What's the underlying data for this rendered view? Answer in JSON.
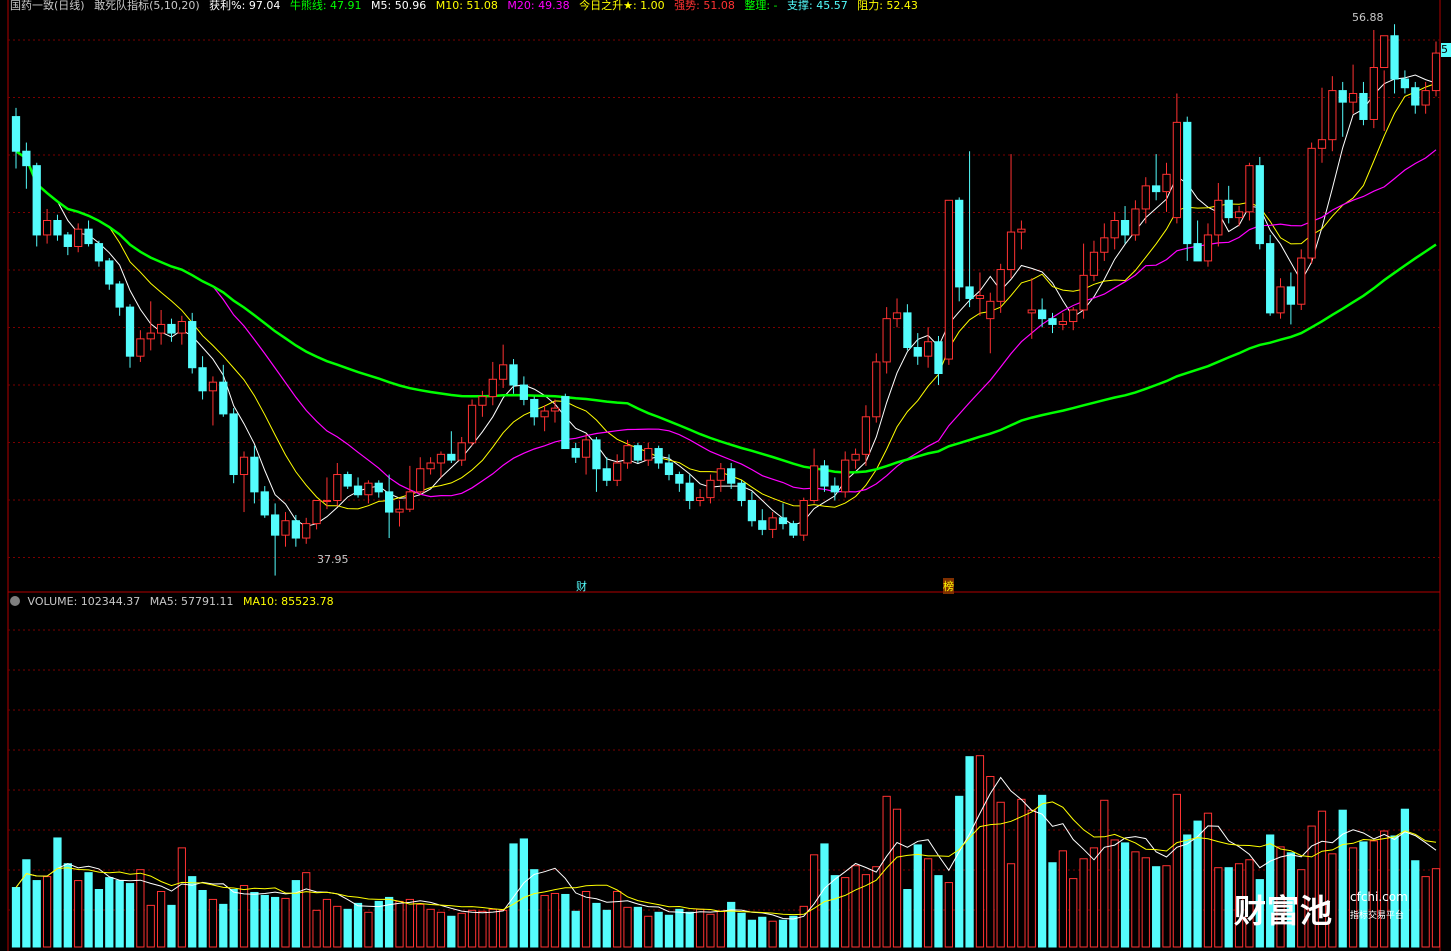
{
  "header": {
    "stock": "国药一致(日线)",
    "indicator": "敢死队指标(5,10,20)",
    "profit": "获利%: 97.04",
    "bull": "牛熊线: 47.91",
    "m5": "M5: 50.96",
    "m10": "M10: 51.08",
    "m20": "M20: 49.38",
    "rise": "今日之升★: 1.00",
    "strong": "强势: 51.08",
    "tidy": "整理: -",
    "support": "支撑: 45.57",
    "resist": "阻力: 52.43"
  },
  "volume_header": {
    "vol": "VOLUME: 102344.37",
    "ma5": "MA5: 57791.11",
    "ma10": "MA10: 85523.78"
  },
  "labels": {
    "high": "56.88",
    "low": "37.95",
    "cai": "财",
    "bang": "榜",
    "edge": "5"
  },
  "colors": {
    "up": "#ff3232",
    "down": "#54fcfc",
    "ma5": "#ffffff",
    "ma10": "#ffff00",
    "ma20": "#ff00ff",
    "ma60": "#00ff00",
    "grid": "#7a0000"
  },
  "watermark": {
    "brand": "财富池",
    "site": "cfchi.com",
    "slogan": "指标交易平台"
  },
  "chart_data": {
    "type": "candlestick",
    "ylim": [
      37.5,
      57.8
    ],
    "candles": [
      [
        53.9,
        54.2,
        52.1,
        52.7
      ],
      [
        52.7,
        53.0,
        51.4,
        52.2
      ],
      [
        52.2,
        52.3,
        49.4,
        49.8
      ],
      [
        49.8,
        50.7,
        49.5,
        50.3
      ],
      [
        50.3,
        50.5,
        49.6,
        49.8
      ],
      [
        49.8,
        49.9,
        49.1,
        49.4
      ],
      [
        49.4,
        50.2,
        49.2,
        50.0
      ],
      [
        50.0,
        50.3,
        49.4,
        49.5
      ],
      [
        49.5,
        49.6,
        48.7,
        48.9
      ],
      [
        48.9,
        49.0,
        47.9,
        48.1
      ],
      [
        48.1,
        48.2,
        47.0,
        47.3
      ],
      [
        47.3,
        47.4,
        45.2,
        45.6
      ],
      [
        45.6,
        46.5,
        45.4,
        46.2
      ],
      [
        46.2,
        47.5,
        45.8,
        46.4
      ],
      [
        46.4,
        47.2,
        46.0,
        46.7
      ],
      [
        46.7,
        46.9,
        46.1,
        46.4
      ],
      [
        46.4,
        47.0,
        46.0,
        46.8
      ],
      [
        46.8,
        47.1,
        45.0,
        45.2
      ],
      [
        45.2,
        45.6,
        44.1,
        44.4
      ],
      [
        44.4,
        44.9,
        43.2,
        44.7
      ],
      [
        44.7,
        45.3,
        43.5,
        43.6
      ],
      [
        43.6,
        43.8,
        41.2,
        41.5
      ],
      [
        41.5,
        42.3,
        40.2,
        42.1
      ],
      [
        42.1,
        42.5,
        40.5,
        40.9
      ],
      [
        40.9,
        41.1,
        40.0,
        40.1
      ],
      [
        40.1,
        40.5,
        38.0,
        39.4
      ],
      [
        39.4,
        40.2,
        39.0,
        39.9
      ],
      [
        39.9,
        40.1,
        39.0,
        39.3
      ],
      [
        39.3,
        40.0,
        39.1,
        39.8
      ],
      [
        39.8,
        40.6,
        39.6,
        40.6
      ],
      [
        40.6,
        41.4,
        40.3,
        40.6
      ],
      [
        40.6,
        41.9,
        40.4,
        41.5
      ],
      [
        41.5,
        41.6,
        41.0,
        41.1
      ],
      [
        41.1,
        41.4,
        40.7,
        40.8
      ],
      [
        40.8,
        41.3,
        40.5,
        41.2
      ],
      [
        41.2,
        41.3,
        40.7,
        40.9
      ],
      [
        40.9,
        41.5,
        39.3,
        40.2
      ],
      [
        40.2,
        40.6,
        39.7,
        40.3
      ],
      [
        40.3,
        41.8,
        40.2,
        40.9
      ],
      [
        40.9,
        42.1,
        40.8,
        41.7
      ],
      [
        41.7,
        42.1,
        41.5,
        41.9
      ],
      [
        41.9,
        42.3,
        41.4,
        42.2
      ],
      [
        42.2,
        43.0,
        41.9,
        42.0
      ],
      [
        42.0,
        42.8,
        41.8,
        42.6
      ],
      [
        42.6,
        44.1,
        42.5,
        43.9
      ],
      [
        43.9,
        44.4,
        43.5,
        44.2
      ],
      [
        44.2,
        45.4,
        43.9,
        44.8
      ],
      [
        44.8,
        46.0,
        44.5,
        45.3
      ],
      [
        45.3,
        45.5,
        44.3,
        44.6
      ],
      [
        44.6,
        44.9,
        43.9,
        44.1
      ],
      [
        44.1,
        44.2,
        43.2,
        43.5
      ],
      [
        43.5,
        43.9,
        43.0,
        43.7
      ],
      [
        43.7,
        44.1,
        43.3,
        43.8
      ],
      [
        44.2,
        44.3,
        42.4,
        42.4
      ],
      [
        42.4,
        42.6,
        41.9,
        42.1
      ],
      [
        42.1,
        42.9,
        41.5,
        42.7
      ],
      [
        42.7,
        42.8,
        40.9,
        41.7
      ],
      [
        41.7,
        42.1,
        41.1,
        41.3
      ],
      [
        41.3,
        42.2,
        41.1,
        41.9
      ],
      [
        41.9,
        42.7,
        41.7,
        42.5
      ],
      [
        42.5,
        42.6,
        41.9,
        42.0
      ],
      [
        42.0,
        42.6,
        41.8,
        42.4
      ],
      [
        42.4,
        42.5,
        41.7,
        41.9
      ],
      [
        41.9,
        42.2,
        41.3,
        41.5
      ],
      [
        41.5,
        41.6,
        40.9,
        41.2
      ],
      [
        41.2,
        41.5,
        40.3,
        40.6
      ],
      [
        40.6,
        41.0,
        40.4,
        40.7
      ],
      [
        40.7,
        41.5,
        40.5,
        41.3
      ],
      [
        41.3,
        41.9,
        40.9,
        41.7
      ],
      [
        41.7,
        41.9,
        41.0,
        41.2
      ],
      [
        41.2,
        41.3,
        40.4,
        40.6
      ],
      [
        40.6,
        40.9,
        39.7,
        39.9
      ],
      [
        39.9,
        40.3,
        39.4,
        39.6
      ],
      [
        39.6,
        40.2,
        39.3,
        40.0
      ],
      [
        40.0,
        40.5,
        39.6,
        39.8
      ],
      [
        39.8,
        39.9,
        39.3,
        39.4
      ],
      [
        39.4,
        40.7,
        39.2,
        40.6
      ],
      [
        40.6,
        42.4,
        40.5,
        41.8
      ],
      [
        41.8,
        42.0,
        40.9,
        41.1
      ],
      [
        41.1,
        41.4,
        40.6,
        40.9
      ],
      [
        40.9,
        42.3,
        40.7,
        42.0
      ],
      [
        42.0,
        42.4,
        41.7,
        42.2
      ],
      [
        42.2,
        43.9,
        41.8,
        43.5
      ],
      [
        43.5,
        45.7,
        43.3,
        45.4
      ],
      [
        45.4,
        47.3,
        45.0,
        46.9
      ],
      [
        46.9,
        47.6,
        46.6,
        47.1
      ],
      [
        47.1,
        47.4,
        45.8,
        45.9
      ],
      [
        45.9,
        46.4,
        45.3,
        45.6
      ],
      [
        45.6,
        46.6,
        45.2,
        46.1
      ],
      [
        46.1,
        46.3,
        44.6,
        45.0
      ],
      [
        45.5,
        51.0,
        45.3,
        51.0
      ],
      [
        51.0,
        51.1,
        47.5,
        48.0
      ],
      [
        48.0,
        52.7,
        47.3,
        47.6
      ],
      [
        47.6,
        48.5,
        47.0,
        47.7
      ],
      [
        46.9,
        47.8,
        45.7,
        47.5
      ],
      [
        47.5,
        48.8,
        47.1,
        48.6
      ],
      [
        48.6,
        52.6,
        48.3,
        49.9
      ],
      [
        49.9,
        50.3,
        49.3,
        50.0
      ],
      [
        47.1,
        48.3,
        46.2,
        47.2
      ],
      [
        47.2,
        47.6,
        46.6,
        46.9
      ],
      [
        46.9,
        47.1,
        46.4,
        46.7
      ],
      [
        46.7,
        47.1,
        46.5,
        46.8
      ],
      [
        46.8,
        47.3,
        46.5,
        47.2
      ],
      [
        47.2,
        49.5,
        46.9,
        48.4
      ],
      [
        48.4,
        49.6,
        48.2,
        49.2
      ],
      [
        49.2,
        50.2,
        48.9,
        49.7
      ],
      [
        49.7,
        50.6,
        49.3,
        50.3
      ],
      [
        50.3,
        50.8,
        49.5,
        49.8
      ],
      [
        49.8,
        51.0,
        49.6,
        50.7
      ],
      [
        50.7,
        51.8,
        50.2,
        51.5
      ],
      [
        51.5,
        52.6,
        51.0,
        51.3
      ],
      [
        51.3,
        52.3,
        50.6,
        51.9
      ],
      [
        50.4,
        54.7,
        50.2,
        53.7
      ],
      [
        53.7,
        53.9,
        48.9,
        49.5
      ],
      [
        49.5,
        50.3,
        49.2,
        48.9
      ],
      [
        48.9,
        50.2,
        48.7,
        49.8
      ],
      [
        49.8,
        51.6,
        49.4,
        51.0
      ],
      [
        51.0,
        51.5,
        50.2,
        50.4
      ],
      [
        50.4,
        50.8,
        50.1,
        50.6
      ],
      [
        50.6,
        52.3,
        50.3,
        52.2
      ],
      [
        52.2,
        52.5,
        49.3,
        49.5
      ],
      [
        49.5,
        49.8,
        47.0,
        47.1
      ],
      [
        47.1,
        48.3,
        46.9,
        48.0
      ],
      [
        48.0,
        48.5,
        46.7,
        47.4
      ],
      [
        47.4,
        49.3,
        47.2,
        49.0
      ],
      [
        49.0,
        53.0,
        48.8,
        52.8
      ],
      [
        52.8,
        54.9,
        52.3,
        53.1
      ],
      [
        53.1,
        55.3,
        52.7,
        54.8
      ],
      [
        54.8,
        55.1,
        53.2,
        54.4
      ],
      [
        54.4,
        55.7,
        54.0,
        54.7
      ],
      [
        54.7,
        55.1,
        53.6,
        53.8
      ],
      [
        53.8,
        56.9,
        53.5,
        55.6
      ],
      [
        55.6,
        55.5,
        53.4,
        56.7
      ],
      [
        56.7,
        57.1,
        54.7,
        55.2
      ],
      [
        55.2,
        55.5,
        54.7,
        54.9
      ],
      [
        54.9,
        55.1,
        54.0,
        54.3
      ],
      [
        54.3,
        55.1,
        54.0,
        54.8
      ],
      [
        54.8,
        56.5,
        54.6,
        56.1
      ]
    ],
    "volume": {
      "ylim": [
        0,
        345000
      ],
      "values": [
        60000,
        88000,
        67000,
        71000,
        110000,
        84000,
        67000,
        75000,
        58000,
        70000,
        67000,
        64000,
        78000,
        42000,
        56000,
        42000,
        100000,
        71000,
        57000,
        48000,
        43000,
        58000,
        62000,
        55000,
        52000,
        50000,
        49000,
        67000,
        75000,
        37000,
        48000,
        41000,
        38000,
        44000,
        35000,
        46000,
        50000,
        46000,
        48000,
        43000,
        38000,
        35000,
        31000,
        34000,
        37000,
        36000,
        38000,
        37000,
        104000,
        109000,
        78000,
        52000,
        54000,
        53000,
        36000,
        56000,
        44000,
        37000,
        56000,
        40000,
        40000,
        31000,
        35000,
        32000,
        38000,
        35000,
        38000,
        33000,
        36000,
        45000,
        34000,
        27000,
        30000,
        26000,
        27000,
        31000,
        41000,
        93000,
        104000,
        72000,
        70000,
        82000,
        73000,
        81000,
        152000,
        139000,
        58000,
        103000,
        89000,
        72000,
        65000,
        152000,
        192000,
        193000,
        172000,
        146000,
        84000,
        149000,
        138000,
        153000,
        85000,
        97000,
        69000,
        89000,
        100000,
        148000,
        108000,
        105000,
        96000,
        90000,
        81000,
        82000,
        154000,
        113000,
        127000,
        135000,
        80000,
        80000,
        84000,
        88000,
        68000,
        113000,
        101000,
        95000,
        78000,
        122000,
        137000,
        94000,
        138000,
        100000,
        106000,
        107000,
        117000,
        112000,
        139000,
        87000,
        71000,
        79000
      ],
      "ma5": [],
      "ma10": []
    }
  }
}
